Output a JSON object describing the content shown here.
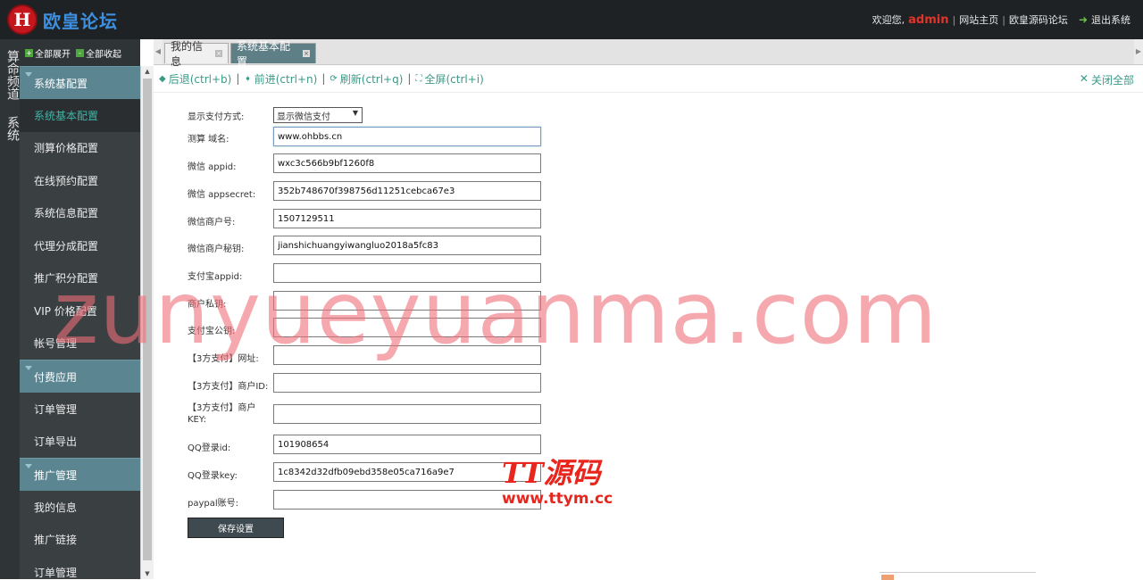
{
  "header": {
    "logo_letter": "H",
    "logo_text": "欧皇论坛",
    "welcome": "欢迎您,",
    "username": "admin",
    "links": [
      "网站主页",
      "欧皇源码论坛"
    ],
    "logout": "退出系统"
  },
  "vstrip": {
    "group1": "算命频道",
    "group2": "系统"
  },
  "sidebar": {
    "expand_all": "全部展开",
    "collapse_all": "全部收起",
    "sections": [
      {
        "title": "系统基配置",
        "items": [
          "系统基本配置",
          "测算价格配置",
          "在线预约配置",
          "系统信息配置",
          "代理分成配置",
          "推广积分配置",
          "VIP 价格配置",
          "帐号管理"
        ]
      },
      {
        "title": "付费应用",
        "items": [
          "订单管理",
          "订单导出"
        ]
      },
      {
        "title": "推广管理",
        "items": [
          "我的信息",
          "推广链接",
          "订单管理"
        ]
      }
    ]
  },
  "tabs": [
    {
      "label": "我的信息"
    },
    {
      "label": "系统基本配置"
    }
  ],
  "nav": {
    "back": "后退(ctrl+b)",
    "forward": "前进(ctrl+n)",
    "refresh": "刷新(ctrl+q)",
    "fullscreen": "全屏(ctrl+i)",
    "close_all": "关闭全部"
  },
  "form": {
    "pay_method_label": "显示支付方式:",
    "pay_method_value": "显示微信支付",
    "fields": [
      {
        "label": "测算 域名:",
        "value": "www.ohbbs.cn"
      },
      {
        "label": "微信 appid:",
        "value": "wxc3c566b9bf1260f8"
      },
      {
        "label": "微信 appsecret:",
        "value": "352b748670f398756d11251cebca67e3"
      },
      {
        "label": "微信商户号:",
        "value": "1507129511"
      },
      {
        "label": "微信商户秘钥:",
        "value": "jianshichuangyiwangluo2018a5fc83"
      },
      {
        "label": "支付宝appid:",
        "value": ""
      },
      {
        "label": "商户私钥:",
        "value": ""
      },
      {
        "label": "支付宝公钥:",
        "value": ""
      },
      {
        "label": "【3方支付】网址:",
        "value": ""
      },
      {
        "label": "【3方支付】商户ID:",
        "value": ""
      },
      {
        "label": "【3方支付】商户KEY:",
        "value": ""
      },
      {
        "label": "QQ登录id:",
        "value": "101908654"
      },
      {
        "label": "QQ登录key:",
        "value": "1c8342d32dfb09ebd358e05ca716a9e7"
      },
      {
        "label": "paypal账号:",
        "value": ""
      }
    ],
    "save_label": "保存设置"
  },
  "watermarks": {
    "main": "zunyueyuanma.com",
    "tt_big": "TT源码",
    "tt_url": "www.ttym.cc"
  },
  "colors": {
    "topbar": "#1e2225",
    "sidebar": "#3a3f42",
    "section_header": "#5a8591",
    "accent": "#3a9a88",
    "admin": "#e0342b"
  }
}
